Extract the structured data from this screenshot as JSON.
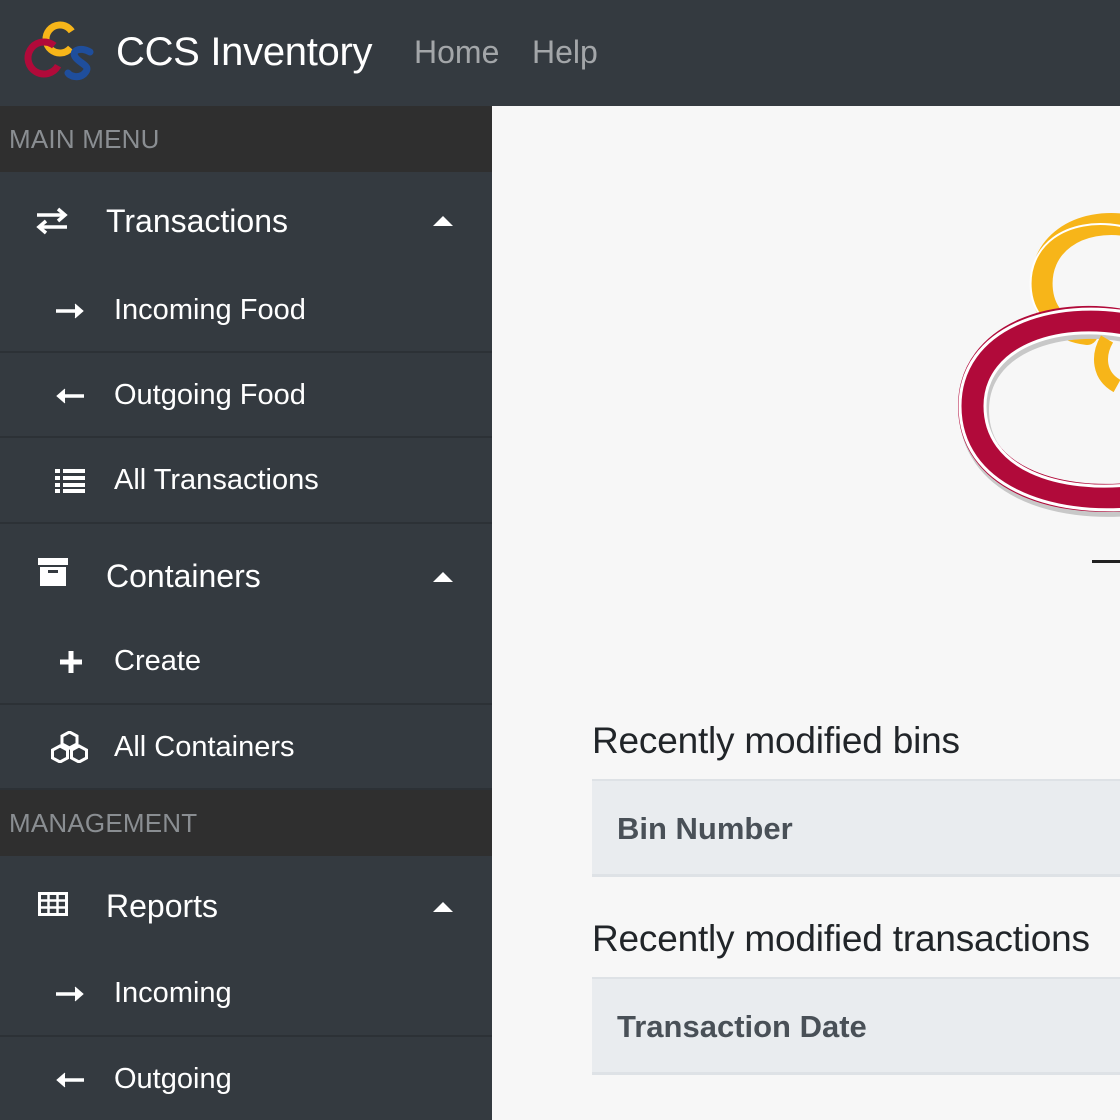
{
  "navbar": {
    "brand": "CCS Inventory",
    "links": [
      "Home",
      "Help"
    ],
    "logo_letters": [
      "C",
      "C",
      "S"
    ]
  },
  "sidebar": {
    "main_menu_header": "MAIN MENU",
    "management_header": "MANAGEMENT",
    "items": [
      {
        "label": "Transactions",
        "icon": "exchange-icon",
        "expanded": true
      },
      {
        "label": "Incoming Food",
        "icon": "arrow-right-icon"
      },
      {
        "label": "Outgoing Food",
        "icon": "arrow-left-icon"
      },
      {
        "label": "All Transactions",
        "icon": "list-icon"
      },
      {
        "label": "Containers",
        "icon": "archive-box-icon",
        "expanded": true
      },
      {
        "label": "Create",
        "icon": "plus-icon"
      },
      {
        "label": "All Containers",
        "icon": "cubes-icon"
      },
      {
        "label": "Reports",
        "icon": "table-grid-icon",
        "expanded": true
      },
      {
        "label": "Incoming",
        "icon": "arrow-right-icon"
      },
      {
        "label": "Outgoing",
        "icon": "arrow-left-icon"
      }
    ]
  },
  "main": {
    "bins_title": "Recently modified bins",
    "bins_header": "Bin Number",
    "transactions_title": "Recently modified transactions",
    "transactions_header": "Transaction Date"
  },
  "colors": {
    "navbar_bg": "#343a40",
    "sidebar_bg": "#343a40",
    "section_header_bg": "#2f2f2f",
    "logo_gold": "#f7b519",
    "logo_crimson": "#b10a3a",
    "logo_blue": "#1f4e9c",
    "content_bg": "#f7f7f7",
    "table_head_bg": "#e9ecef"
  }
}
